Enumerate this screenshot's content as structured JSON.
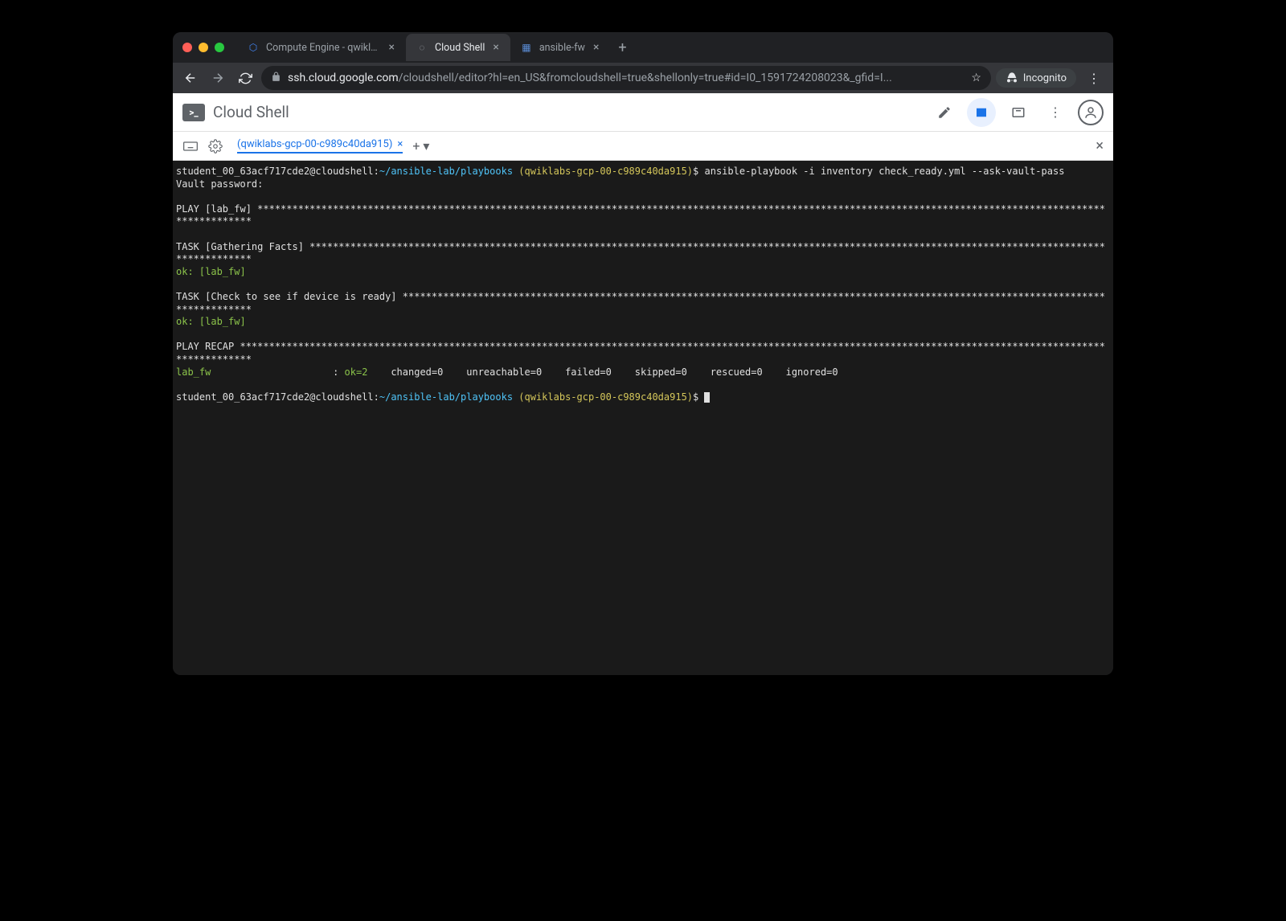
{
  "browser": {
    "tabs": [
      {
        "title": "Compute Engine - qwiklabs-gc",
        "favicon": "⬡"
      },
      {
        "title": "Cloud Shell",
        "favicon": "◌"
      },
      {
        "title": "ansible-fw",
        "favicon": "▦"
      }
    ],
    "url_host": "ssh.cloud.google.com",
    "url_path": "/cloudshell/editor?hl=en_US&fromcloudshell=true&shellonly=true#id=I0_1591724208023&_gfid=I...",
    "incognito_label": "Incognito"
  },
  "app": {
    "title": "Cloud Shell",
    "term_tab": "(qwiklabs-gcp-00-c989c40da915)"
  },
  "terminal": {
    "user": "student_00_63acf717cde2@cloudshell",
    "path": "~/ansible-lab/playbooks",
    "project": "(qwiklabs-gcp-00-c989c40da915)",
    "cmd1": " ansible-playbook -i inventory check_ready.yml --ask-vault-pass",
    "vault_prompt": "Vault password:",
    "play_header": "PLAY [lab_fw] ",
    "task1": "TASK [Gathering Facts] ",
    "ok1": "ok: [lab_fw]",
    "task2": "TASK [Check to see if device is ready] ",
    "ok2": "ok: [lab_fw]",
    "recap_header": "PLAY RECAP ",
    "recap_host": "lab_fw",
    "recap_ok": "ok=2",
    "recap_rest": "    changed=0    unreachable=0    failed=0    skipped=0    rescued=0    ignored=0"
  }
}
